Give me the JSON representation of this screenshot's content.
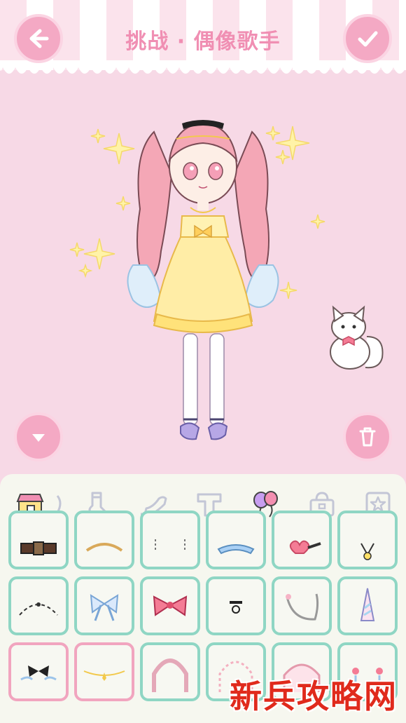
{
  "header": {
    "title": "挑战 · 偶像歌手",
    "back_icon": "arrow-left-icon",
    "confirm_icon": "checkmark-icon"
  },
  "stage": {
    "character": "doll-yellow-dress",
    "pet": "white-cat-pet",
    "collapse_icon": "chevron-down-icon",
    "trash_icon": "trash-icon"
  },
  "categories": [
    {
      "name": "shop-icon",
      "active": false
    },
    {
      "name": "partial-item-icon",
      "active": false
    },
    {
      "name": "sock-icon",
      "active": false
    },
    {
      "name": "high-heel-icon",
      "active": false
    },
    {
      "name": "letter-t-icon",
      "active": false
    },
    {
      "name": "balloons-icon",
      "active": true
    },
    {
      "name": "bag-icon",
      "active": false
    },
    {
      "name": "star-frame-icon",
      "active": false
    }
  ],
  "items": [
    {
      "name": "belt-item",
      "selected": false
    },
    {
      "name": "tiara-gold-item",
      "selected": false
    },
    {
      "name": "earring-chain-item",
      "selected": false
    },
    {
      "name": "tiara-blue-item",
      "selected": false
    },
    {
      "name": "heart-hairpin-item",
      "selected": false
    },
    {
      "name": "star-necklace-item",
      "selected": false
    },
    {
      "name": "star-headband-item",
      "selected": false
    },
    {
      "name": "blue-bow-item",
      "selected": false
    },
    {
      "name": "pink-bow-item",
      "selected": false
    },
    {
      "name": "choker-item",
      "selected": false
    },
    {
      "name": "pink-strap-item",
      "selected": false
    },
    {
      "name": "unicorn-horn-item",
      "selected": false
    },
    {
      "name": "black-bow-headpiece-item",
      "selected": true
    },
    {
      "name": "gold-circlet-item",
      "selected": true
    },
    {
      "name": "pink-veil-arch-item",
      "selected": false
    },
    {
      "name": "flower-crown-arch-item",
      "selected": false
    },
    {
      "name": "lace-bonnet-item",
      "selected": false
    },
    {
      "name": "flower-pins-item",
      "selected": false
    }
  ],
  "colors": {
    "accent_pink": "#f4a9c4",
    "title_pink": "#f08fb3",
    "cell_border_mint": "#8fd6c4",
    "cell_border_selected": "#f1a5bf",
    "watermark_red": "#e02a1c"
  },
  "watermark": "新兵攻略网"
}
